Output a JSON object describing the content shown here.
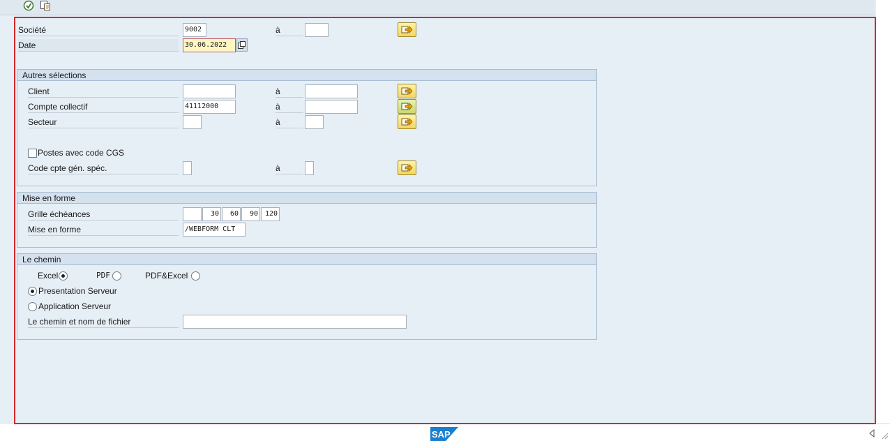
{
  "toolbar": {
    "icons": [
      "execute-icon",
      "variant-icon"
    ]
  },
  "header": {
    "societe": {
      "label": "Société",
      "from": "9002",
      "to_label": "à",
      "to": ""
    },
    "date": {
      "label": "Date",
      "value": "30.06.2022"
    }
  },
  "autres": {
    "title": "Autres sélections",
    "client": {
      "label": "Client",
      "from": "",
      "to_label": "à",
      "to": ""
    },
    "compte": {
      "label": "Compte collectif",
      "from": "41112000",
      "to_label": "à",
      "to": ""
    },
    "secteur": {
      "label": "Secteur",
      "from": "",
      "to_label": "à",
      "to": ""
    },
    "postes": {
      "label": "Postes avec code CGS",
      "checked": false
    },
    "code": {
      "label": "Code cpte gén. spéc.",
      "from": "",
      "to_label": "à",
      "to": ""
    }
  },
  "forme": {
    "title": "Mise en forme",
    "grille": {
      "label": "Grille échéances",
      "values": [
        "",
        "30",
        "60",
        "90",
        "120"
      ]
    },
    "mise": {
      "label": "Mise en forme",
      "value": "/WEBFORM CLT"
    }
  },
  "chemin": {
    "title": "Le chemin",
    "excel": {
      "label": "Excel",
      "selected": true
    },
    "pdf": {
      "label": "PDF",
      "selected": false
    },
    "pdfexcel": {
      "label": "PDF&Excel",
      "selected": false
    },
    "presentation": {
      "label": "Presentation Serveur",
      "selected": true
    },
    "application": {
      "label": "Application Serveur",
      "selected": false
    },
    "fichier": {
      "label": "Le chemin et nom de fichier",
      "value": ""
    }
  },
  "footer": {
    "logo_text": "SAP"
  },
  "colors": {
    "frame": "#d22a2a",
    "section_head": "#d4e1ee",
    "button": "#f3d664"
  }
}
